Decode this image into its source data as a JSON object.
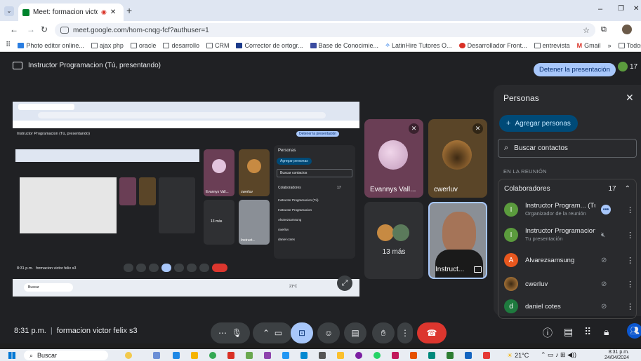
{
  "browser": {
    "tab_title": "Meet: formacion victor felix",
    "url": "meet.google.com/hom-cnqg-fcf?authuser=1",
    "bookmarks": [
      "Photo editor online...",
      "ajax php",
      "oracle",
      "desarrollo",
      "CRM",
      "Corrector de ortogr...",
      "Base de Conocimie...",
      "LatinHire Tutores O...",
      "Desarrollador Front...",
      "entrevista",
      "Gmail",
      "Todos los marcadores"
    ],
    "window_controls": [
      "–",
      "❐",
      "✕"
    ]
  },
  "meet": {
    "presenter_label": "Instructor Programacion (Tú, presentando)",
    "stop_presenting": "Detener la presentación",
    "participant_count": "17",
    "time": "8:31 p.m.",
    "meeting_name": "formacion victor felix s3"
  },
  "tiles": [
    {
      "name": "Evannys Vall..."
    },
    {
      "name": "cwerluv"
    },
    {
      "name": "13 más"
    },
    {
      "name": "Instruct..."
    }
  ],
  "panel": {
    "title": "Personas",
    "add_people": "Agregar personas",
    "search_placeholder": "Buscar contactos",
    "section_label": "EN LA REUNIÓN",
    "group_name": "Colaboradores",
    "group_count": "17",
    "participants": [
      {
        "initial": "I",
        "name": "Instructor Program... (Tú)",
        "subtitle": "Organizador de la reunión",
        "color": "#5b9b3d"
      },
      {
        "initial": "I",
        "name": "Instructor Programacion",
        "subtitle": "Tu presentación",
        "color": "#5b9b3d"
      },
      {
        "initial": "A",
        "name": "Alvarezsamsung",
        "subtitle": "",
        "color": "#e8571e"
      },
      {
        "initial": "",
        "name": "cwerluv",
        "subtitle": "",
        "color": "#8a6a3a"
      },
      {
        "initial": "d",
        "name": "daniel cotes",
        "subtitle": "",
        "color": "#1e7a3e"
      }
    ]
  },
  "mini": {
    "presenter_label": "Instructor Programacion (Tú, presentando)",
    "stop": "Detener la presentación",
    "panel_title": "Personas",
    "add": "Agregar personas",
    "search": "Buscar contactos",
    "group": "Colaboradores",
    "group_count": "17",
    "rows": [
      "Instructor Programacion (Tú)",
      "Instructor Programacion",
      "Alvarezsamsung",
      "cwerluv",
      "daniel cotes"
    ],
    "time": "8:31 p.m.",
    "meeting_name": "formacion victor felix s3",
    "tile_name_1": "Evannys Vall...",
    "tile_name_2": "cwerluv",
    "more": "13 más",
    "instructor": "Instruct...",
    "taskbar_search": "Buscar",
    "temp": "21°C"
  },
  "taskbar": {
    "search": "Buscar",
    "temperature": "21°C",
    "clock_time": "8:31 p.m.",
    "clock_date": "24/04/2024"
  }
}
